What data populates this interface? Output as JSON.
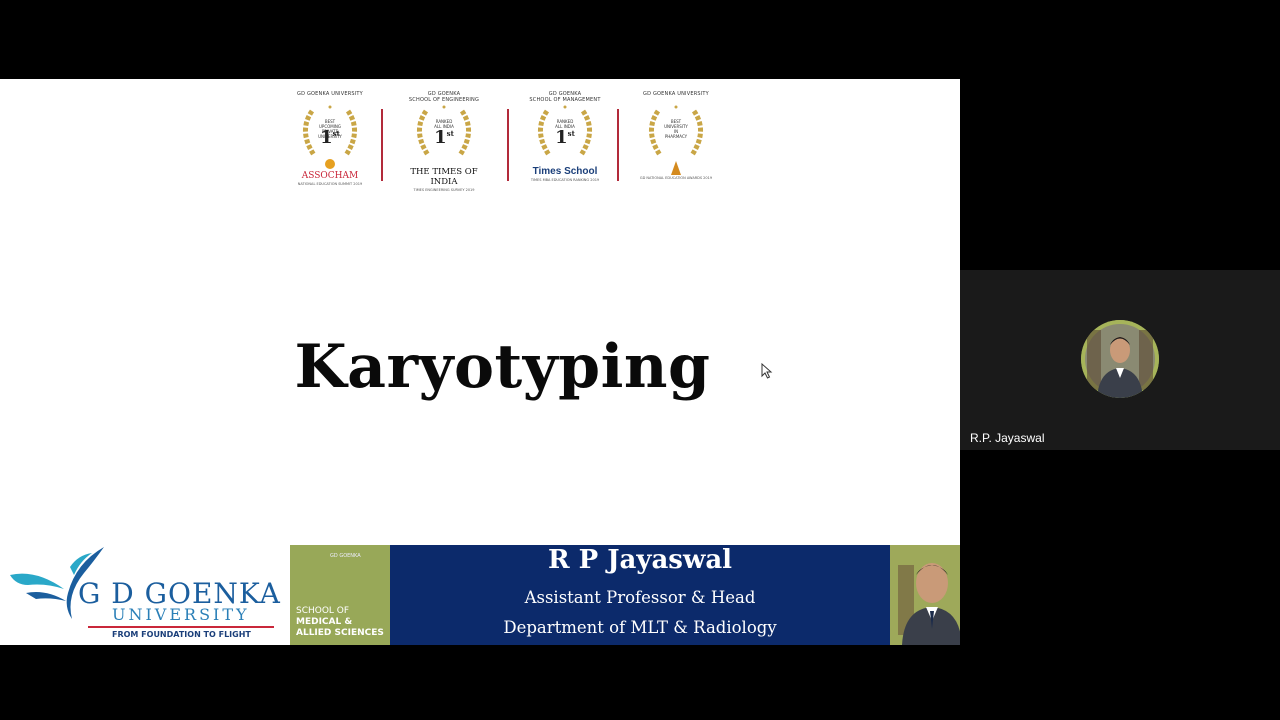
{
  "slide": {
    "title": "Karyotyping",
    "awards": [
      {
        "header": "GD GOENKA UNIVERSITY",
        "inner": "BEST\nUPCOMING\nPRIVATE\nUNIVERSITY",
        "rank": "1",
        "rank_sup": "st",
        "brand": "ASSOCHAM",
        "footer": "NATIONAL EDUCATION SUMMIT 2019"
      },
      {
        "header": "GD GOENKA\nSCHOOL OF ENGINEERING",
        "inner": "RANKED\nALL INDIA",
        "rank": "1",
        "rank_sup": "st",
        "brand": "THE TIMES OF INDIA",
        "footer": "TIMES ENGINEERING SURVEY 2019"
      },
      {
        "header": "GD GOENKA\nSCHOOL OF MANAGEMENT",
        "inner": "RANKED\nALL INDIA",
        "rank": "1",
        "rank_sup": "st",
        "brand": "Times School",
        "footer": "TIMES MBA EDUCATION RANKING 2019"
      },
      {
        "header": "GD GOENKA UNIVERSITY",
        "inner": "BEST\nUNIVERSITY\nIN\nPHARMACY",
        "rank": "",
        "rank_sup": "",
        "brand": "",
        "footer": "GD NATIONAL EDUCATION AWARDS 2019"
      }
    ],
    "banner": {
      "logo_name": "G D GOENKA",
      "logo_university": "UNIVERSITY",
      "logo_tagline": "FROM FOUNDATION TO FLIGHT",
      "school_line1": "SCHOOL OF",
      "school_line2": "MEDICAL &",
      "school_line3": "ALLIED SCIENCES",
      "school_mini": "GD GOENKA",
      "presenter_name": "R P Jayaswal",
      "presenter_role": "Assistant Professor & Head",
      "presenter_dept": "Department of MLT & Radiology"
    }
  },
  "participants": [
    {
      "name": "R.P. Jayaswal",
      "avatar": "user-photo"
    }
  ],
  "colors": {
    "banner_navy": "#0c2a6b",
    "banner_olive": "#98a858",
    "logo_blue": "#1b5e9e",
    "award_gold": "#c9a646",
    "divider_red": "#b22a3a"
  }
}
